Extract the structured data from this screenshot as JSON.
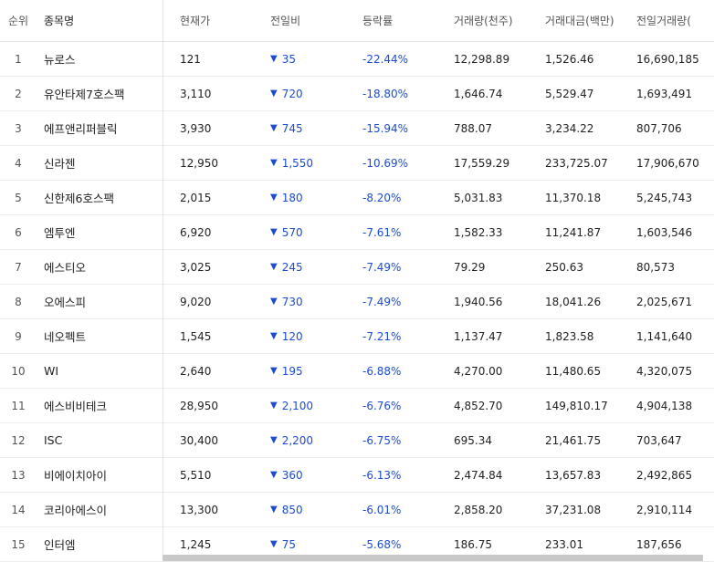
{
  "headers": {
    "rank": "순위",
    "name": "종목명",
    "price": "현재가",
    "change": "전일비",
    "rate": "등락률",
    "volume": "거래량(천주)",
    "amount": "거래대금(백만)",
    "prev_volume": "전일거래량("
  },
  "down_arrow": "▼",
  "rows": [
    {
      "rank": "1",
      "name": "뉴로스",
      "price": "121",
      "change": "35",
      "rate": "-22.44%",
      "volume": "12,298.89",
      "amount": "1,526.46",
      "prev_volume": "16,690,185"
    },
    {
      "rank": "2",
      "name": "유안타제7호스팩",
      "price": "3,110",
      "change": "720",
      "rate": "-18.80%",
      "volume": "1,646.74",
      "amount": "5,529.47",
      "prev_volume": "1,693,491"
    },
    {
      "rank": "3",
      "name": "에프앤리퍼블릭",
      "price": "3,930",
      "change": "745",
      "rate": "-15.94%",
      "volume": "788.07",
      "amount": "3,234.22",
      "prev_volume": "807,706"
    },
    {
      "rank": "4",
      "name": "신라젠",
      "price": "12,950",
      "change": "1,550",
      "rate": "-10.69%",
      "volume": "17,559.29",
      "amount": "233,725.07",
      "prev_volume": "17,906,670"
    },
    {
      "rank": "5",
      "name": "신한제6호스팩",
      "price": "2,015",
      "change": "180",
      "rate": "-8.20%",
      "volume": "5,031.83",
      "amount": "11,370.18",
      "prev_volume": "5,245,743"
    },
    {
      "rank": "6",
      "name": "엠투엔",
      "price": "6,920",
      "change": "570",
      "rate": "-7.61%",
      "volume": "1,582.33",
      "amount": "11,241.87",
      "prev_volume": "1,603,546"
    },
    {
      "rank": "7",
      "name": "에스티오",
      "price": "3,025",
      "change": "245",
      "rate": "-7.49%",
      "volume": "79.29",
      "amount": "250.63",
      "prev_volume": "80,573"
    },
    {
      "rank": "8",
      "name": "오에스피",
      "price": "9,020",
      "change": "730",
      "rate": "-7.49%",
      "volume": "1,940.56",
      "amount": "18,041.26",
      "prev_volume": "2,025,671"
    },
    {
      "rank": "9",
      "name": "네오펙트",
      "price": "1,545",
      "change": "120",
      "rate": "-7.21%",
      "volume": "1,137.47",
      "amount": "1,823.58",
      "prev_volume": "1,141,640"
    },
    {
      "rank": "10",
      "name": "WI",
      "price": "2,640",
      "change": "195",
      "rate": "-6.88%",
      "volume": "4,270.00",
      "amount": "11,480.65",
      "prev_volume": "4,320,075"
    },
    {
      "rank": "11",
      "name": "에스비비테크",
      "price": "28,950",
      "change": "2,100",
      "rate": "-6.76%",
      "volume": "4,852.70",
      "amount": "149,810.17",
      "prev_volume": "4,904,138"
    },
    {
      "rank": "12",
      "name": "ISC",
      "price": "30,400",
      "change": "2,200",
      "rate": "-6.75%",
      "volume": "695.34",
      "amount": "21,461.75",
      "prev_volume": "703,647"
    },
    {
      "rank": "13",
      "name": "비에이치아이",
      "price": "5,510",
      "change": "360",
      "rate": "-6.13%",
      "volume": "2,474.84",
      "amount": "13,657.83",
      "prev_volume": "2,492,865"
    },
    {
      "rank": "14",
      "name": "코리아에스이",
      "price": "13,300",
      "change": "850",
      "rate": "-6.01%",
      "volume": "2,858.20",
      "amount": "37,231.08",
      "prev_volume": "2,910,114"
    },
    {
      "rank": "15",
      "name": "인터엠",
      "price": "1,245",
      "change": "75",
      "rate": "-5.68%",
      "volume": "186.75",
      "amount": "233.01",
      "prev_volume": "187,656"
    }
  ],
  "colors": {
    "down": "#1e4cd1",
    "border": "#e3e3e3"
  }
}
